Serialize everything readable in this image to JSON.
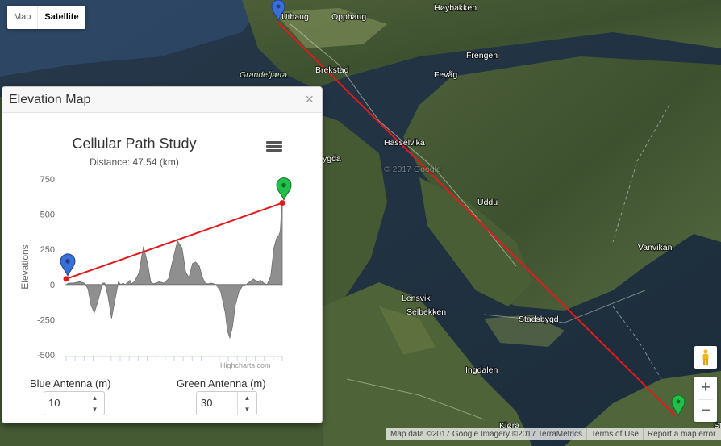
{
  "map": {
    "type_buttons": [
      "Map",
      "Satellite"
    ],
    "active_type": "Satellite",
    "place_labels": [
      "Uthaug",
      "Opphaug",
      "Høybakken",
      "Grandefjæra",
      "Brekstad",
      "Frengen",
      "Fevåg",
      "Hasselvika",
      "Uddu",
      "Vanvikan",
      "Lensvik",
      "Selbekken",
      "Stadsbygd",
      "Ingdalen",
      "Kjøra",
      "ygda",
      "St"
    ],
    "watermark": "© 2017 Google",
    "zoom_in": "+",
    "zoom_out": "−",
    "attribution": {
      "data": "Map data ©2017 Google Imagery ©2017 TerraMetrics",
      "terms": "Terms of Use",
      "report": "Report a map error"
    },
    "icons": [
      "pegman-icon",
      "blue-marker-icon",
      "green-marker-icon"
    ],
    "colors": {
      "path_line": "#e31a1c",
      "blue_marker": "#3b6fd8",
      "green_marker": "#22c04a"
    }
  },
  "dialog": {
    "title": "Elevation Map",
    "close": "×",
    "blue_antenna_label": "Blue Antenna (m)",
    "green_antenna_label": "Green Antenna (m)",
    "blue_antenna_value": "10",
    "green_antenna_value": "30",
    "spinner_up": "▲",
    "spinner_down": "▼"
  },
  "chart_data": {
    "type": "area",
    "title": "Cellular Path Study",
    "subtitle": "Distance: 47.54 (km)",
    "ylabel": "Elevations",
    "ylim": [
      -500,
      750
    ],
    "yticks": [
      750,
      500,
      250,
      0,
      -250,
      -500
    ],
    "credits": "Highcharts.com",
    "menu_icon": "hamburger-icon",
    "x_range": [
      0,
      47.54
    ],
    "terrain": {
      "x": [
        0,
        0.5,
        1.5,
        3,
        4,
        4.8,
        5.5,
        6.2,
        7,
        8,
        8.5,
        9.2,
        10,
        10.8,
        11.5,
        12,
        12.5,
        13,
        13.6,
        14,
        14.4,
        15,
        16,
        17,
        18,
        18.6,
        19.2,
        19.7,
        20.5,
        21.5,
        22.5,
        23.5,
        24.5,
        25.5,
        26.3,
        27,
        27.8,
        28.5,
        29.3,
        30,
        30.6,
        31.2,
        32,
        33,
        34,
        35,
        35.5,
        36,
        36.6,
        37.2,
        38,
        38.8,
        39.6,
        40.4,
        41.2,
        42,
        42.8,
        43.5,
        44.2,
        45,
        45.7,
        46.3,
        46.8,
        47.1,
        47.3,
        47.54
      ],
      "y": [
        0,
        10,
        10,
        20,
        10,
        -30,
        -150,
        -200,
        -120,
        10,
        10,
        -80,
        -240,
        -100,
        20,
        0,
        10,
        0,
        15,
        30,
        5,
        20,
        80,
        270,
        140,
        20,
        5,
        10,
        20,
        10,
        40,
        180,
        310,
        260,
        90,
        50,
        150,
        160,
        130,
        50,
        10,
        5,
        10,
        0,
        -50,
        -200,
        -330,
        -380,
        -300,
        -150,
        -50,
        -10,
        0,
        20,
        40,
        20,
        30,
        10,
        0,
        60,
        260,
        330,
        350,
        380,
        500,
        580
      ]
    },
    "path_line": {
      "x": [
        0,
        47.54
      ],
      "y": [
        40,
        580
      ]
    }
  }
}
